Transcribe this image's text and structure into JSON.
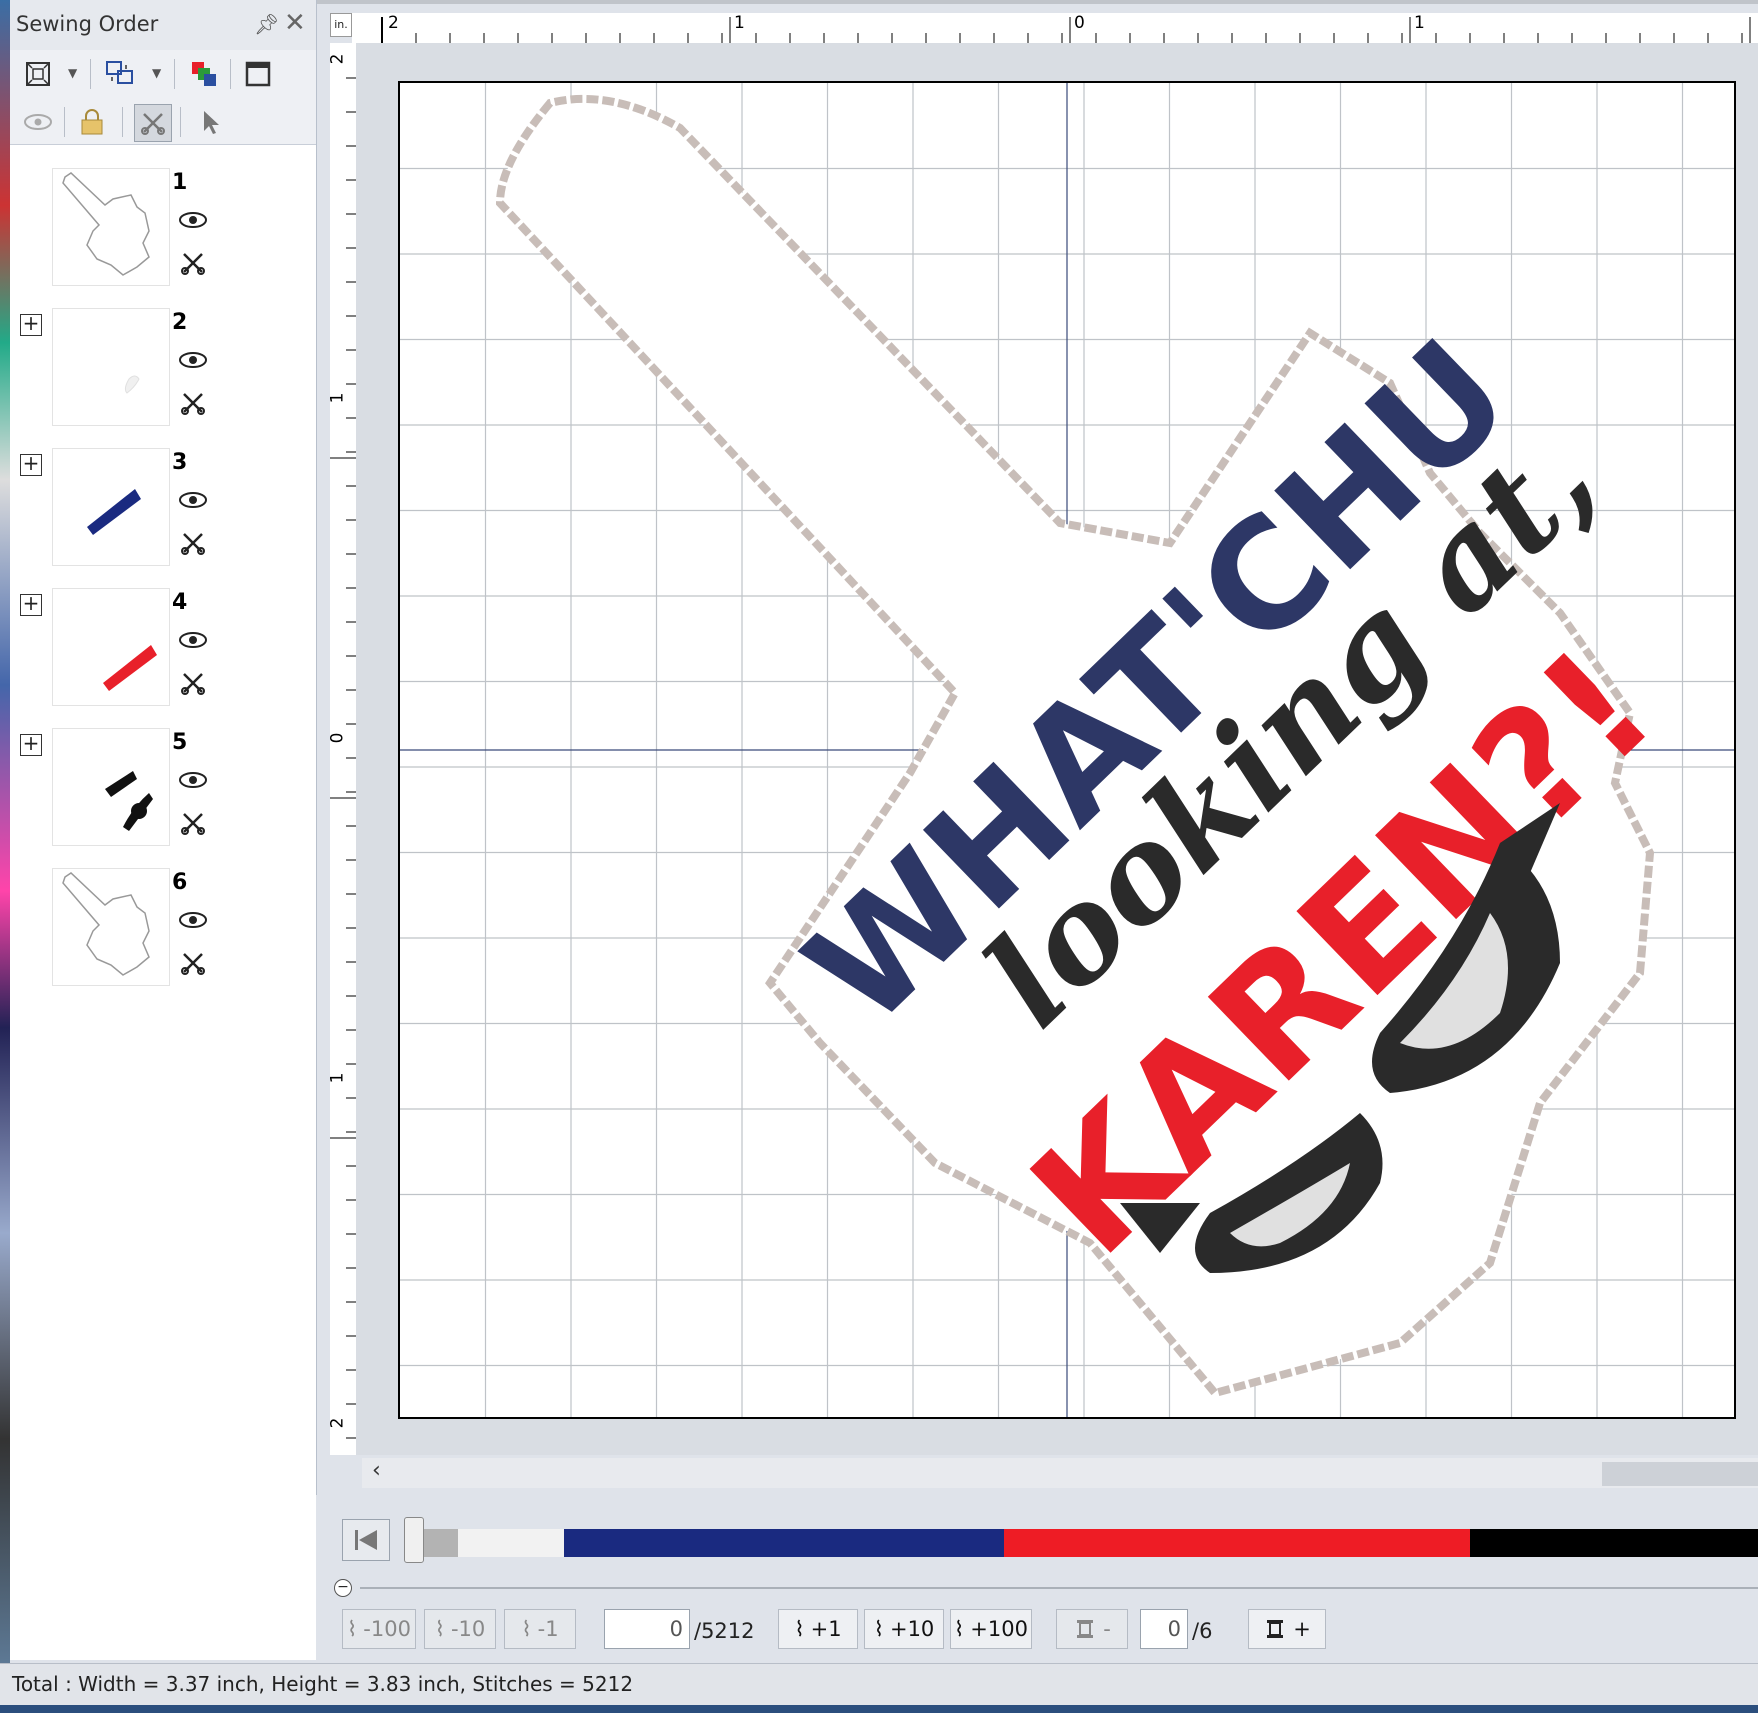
{
  "panel": {
    "title": "Sewing Order",
    "pin_icon": "pin-icon",
    "close_icon": "close-icon",
    "items": [
      {
        "number": "1"
      },
      {
        "number": "2"
      },
      {
        "number": "3"
      },
      {
        "number": "4"
      },
      {
        "number": "5"
      },
      {
        "number": "6"
      }
    ]
  },
  "ruler": {
    "unit": "in.",
    "top_labels": [
      "2",
      "1",
      "0",
      "1"
    ],
    "left_labels": [
      "2",
      "1",
      "0",
      "1",
      "2"
    ]
  },
  "design": {
    "line1": "WHAT'CHU",
    "line2": "looking at,",
    "line3": "KAREN?!",
    "colors": {
      "navy": "#2d3766",
      "red": "#e8202a",
      "black": "#2a2a2a",
      "gray": "#d9d9d9"
    }
  },
  "thread_colors": [
    "#b3b3b3",
    "#f2f2f2",
    "#1a2a80",
    "#ee1c25",
    "#000000"
  ],
  "player": {
    "btn_minus100": "-100",
    "btn_minus10": "-10",
    "btn_minus1": "-1",
    "stitch_current": "0",
    "stitch_total": "/5212",
    "btn_plus1": "+1",
    "btn_plus10": "+10",
    "btn_plus100": "+100",
    "color_minus": "-",
    "color_current": "0",
    "color_total": "/6",
    "color_plus": "+"
  },
  "status": {
    "text": "Total : Width = 3.37 inch, Height = 3.83 inch, Stitches = 5212"
  }
}
